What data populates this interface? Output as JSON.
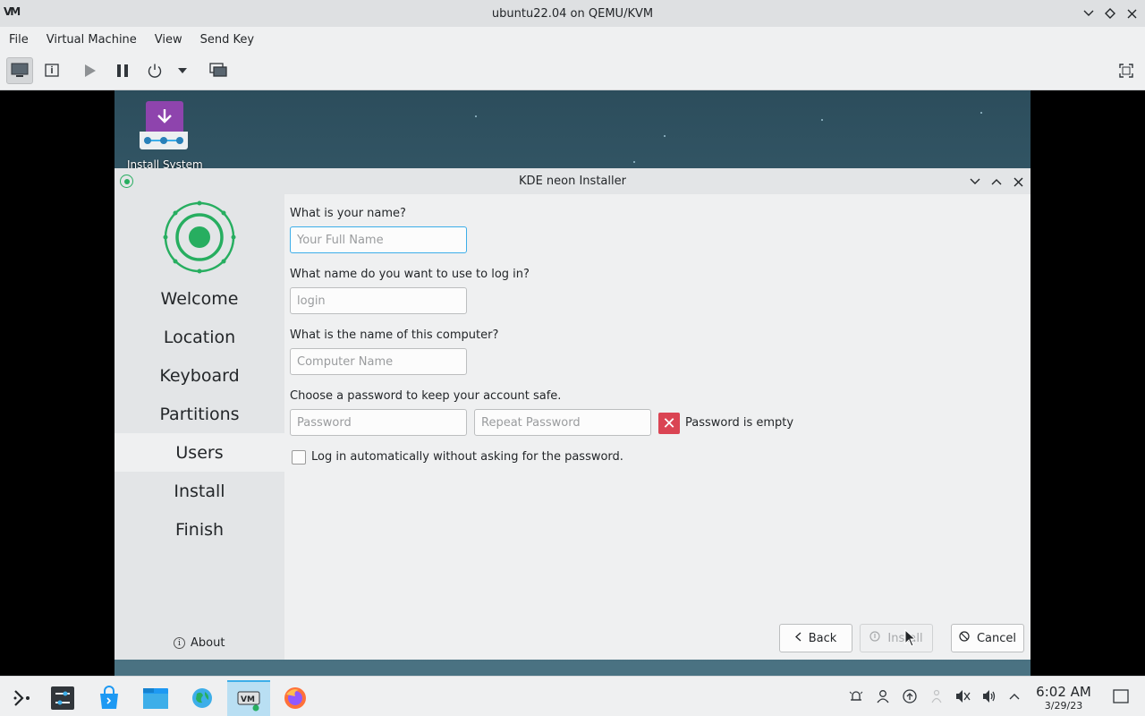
{
  "host": {
    "title": "ubuntu22.04 on QEMU/KVM",
    "logo_text": "VM",
    "menu": [
      "File",
      "Virtual Machine",
      "View",
      "Send Key"
    ],
    "toolbar_icons": [
      "console-icon",
      "details-icon",
      "run-icon",
      "pause-icon",
      "power-icon",
      "dropdown-arrow-icon",
      "snapshots-icon",
      "fullscreen-icon"
    ]
  },
  "desktop": {
    "install_icon_label": "Install System"
  },
  "installer": {
    "title": "KDE neon Installer",
    "steps": [
      "Welcome",
      "Location",
      "Keyboard",
      "Partitions",
      "Users",
      "Install",
      "Finish"
    ],
    "current_step": "Users",
    "about_label": "About",
    "form": {
      "name_question": "What is your name?",
      "name_placeholder": "Your Full Name",
      "login_question": "What name do you want to use to log in?",
      "login_placeholder": "login",
      "computer_question": "What is the name of this computer?",
      "computer_placeholder": "Computer Name",
      "password_question": "Choose a password to keep your account safe.",
      "password_placeholder": "Password",
      "repeat_placeholder": "Repeat Password",
      "password_error": "Password is empty",
      "autologin_label": "Log in automatically without asking for the password.",
      "autologin_checked": false
    },
    "buttons": {
      "back": "Back",
      "install": "Install",
      "cancel": "Cancel"
    },
    "accent_color": "#3daee9",
    "error_color": "#da4453",
    "logo_color": "#27ae60"
  },
  "taskbar": {
    "time": "6:02 AM",
    "date": "3/29/23"
  }
}
